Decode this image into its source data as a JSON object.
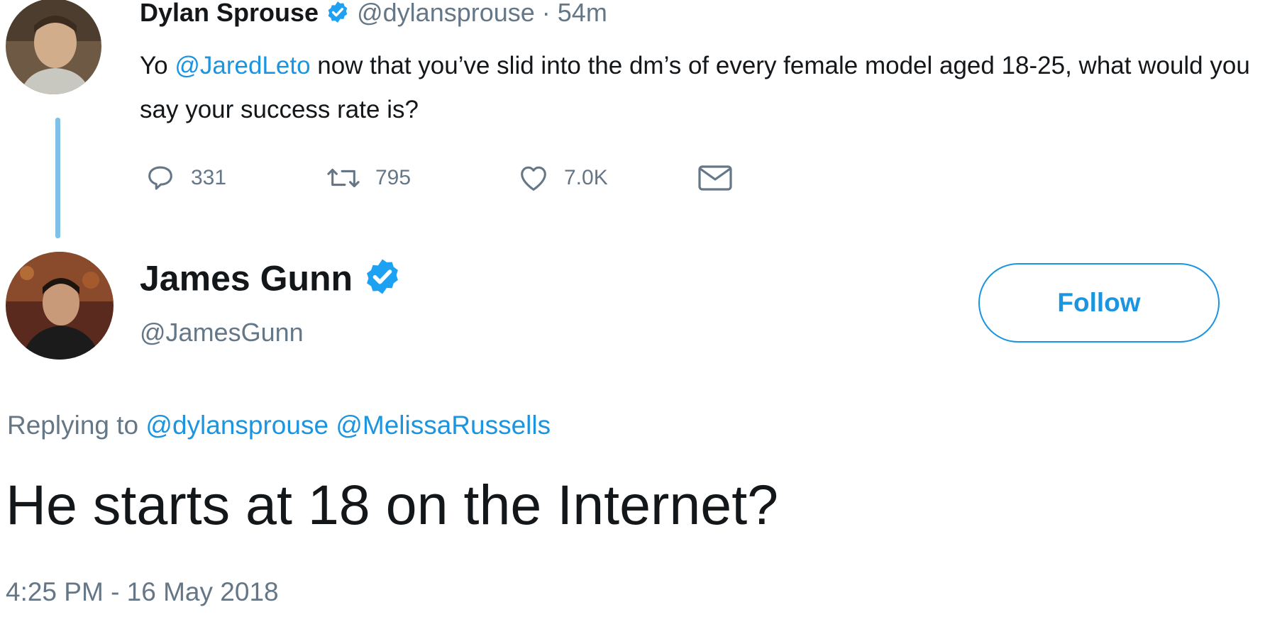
{
  "colors": {
    "link": "#1b95e0",
    "muted": "#657786",
    "text": "#14171a",
    "thread_line": "#7fc1e6"
  },
  "tweet1": {
    "avatar_icon": "profile-photo",
    "name": "Dylan Sprouse",
    "verified_icon": "verified-badge-icon",
    "handle": "@dylansprouse",
    "sep_time": " · 54m",
    "text_prefix": "Yo ",
    "mention": "@JaredLeto",
    "text_rest": " now that you’ve slid into the dm’s of every female model aged 18-25, what would you say your success rate is?",
    "actions": {
      "reply_icon": "reply-icon",
      "reply_count": "331",
      "retweet_icon": "retweet-icon",
      "retweet_count": "795",
      "like_icon": "heart-icon",
      "like_count": "7.0K",
      "dm_icon": "envelope-icon"
    }
  },
  "tweet2": {
    "avatar_icon": "profile-photo",
    "name": "James Gunn",
    "verified_icon": "verified-badge-icon",
    "handle": "@JamesGunn",
    "follow_label": "Follow",
    "replying_label": "Replying to",
    "replying_to": [
      "@dylansprouse",
      "@MelissaRussells"
    ],
    "text": "He starts at 18 on the Internet?",
    "timestamp": "4:25 PM - 16 May 2018"
  }
}
